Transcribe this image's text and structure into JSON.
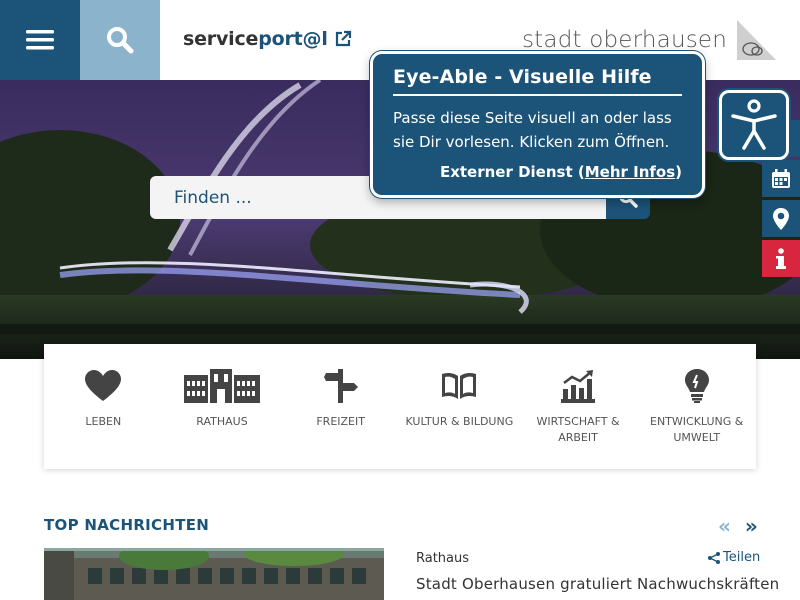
{
  "header": {
    "serviceportal_prefix": "service",
    "serviceportal_suffix": "port@l",
    "logo_text": "stadt oberhausen"
  },
  "search": {
    "placeholder": "Finden ..."
  },
  "eye_able": {
    "title": "Eye-Able - Visuelle Hilfe",
    "text": "Passe diese Seite visuell an oder lass sie Dir vorlesen. Klicken zum Öffnen.",
    "ext_prefix": "Externer Dienst (",
    "ext_link": "Mehr Infos",
    "ext_suffix": ")"
  },
  "side_tools": [
    "calendar-icon",
    "location-pin-icon",
    "info-icon"
  ],
  "categories": [
    {
      "label": "LEBEN",
      "icon": "heart-icon"
    },
    {
      "label": "RATHAUS",
      "icon": "town-hall-icon"
    },
    {
      "label": "FREIZEIT",
      "icon": "signpost-icon"
    },
    {
      "label": "KULTUR & BILDUNG",
      "icon": "book-icon"
    },
    {
      "label": "WIRTSCHAFT & ARBEIT",
      "icon": "chart-icon"
    },
    {
      "label": "ENTWICKLUNG & UMWELT",
      "icon": "lightbulb-icon"
    }
  ],
  "news": {
    "section_title": "TOP NACHRICHTEN",
    "prev": "«",
    "next": "»",
    "category": "Rathaus",
    "share_label": "Teilen",
    "headline": "Stadt Oberhausen gratuliert Nachwuchskräften"
  },
  "colors": {
    "primary": "#1c5378",
    "light_blue": "#8bb4cc",
    "info_red": "#d7263d"
  }
}
